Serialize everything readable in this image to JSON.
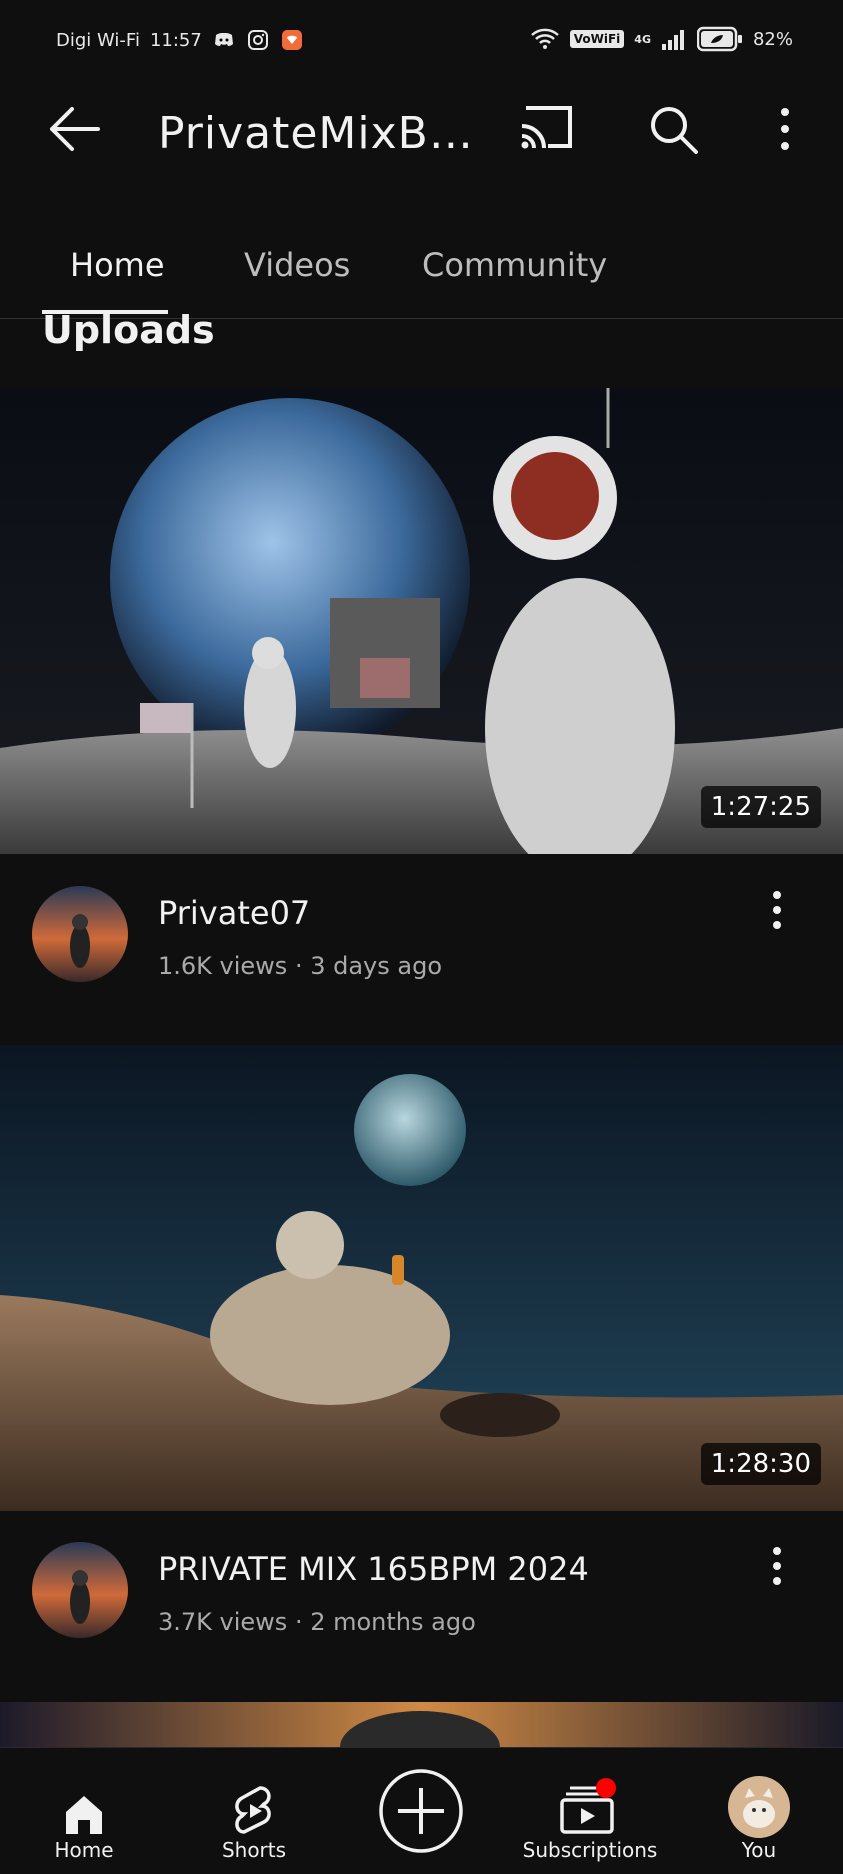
{
  "status": {
    "carrier": "Digi Wi-Fi",
    "time": "11:57",
    "vowifi": "VoWiFi",
    "network": "4G",
    "battery": "82%"
  },
  "header": {
    "title": "PrivateMixBi ..."
  },
  "tabs": [
    {
      "label": "Home"
    },
    {
      "label": "Videos"
    },
    {
      "label": "Community"
    }
  ],
  "section_title": "Uploads",
  "videos": [
    {
      "title": "Private07",
      "views": "1.6K views",
      "age": "3 days ago",
      "duration": "1:27:25"
    },
    {
      "title": "PRIVATE MIX 165BPM 2024",
      "views": "3.7K views",
      "age": "2 months ago",
      "duration": "1:28:30"
    }
  ],
  "meta_separator": " · ",
  "nav": [
    {
      "label": "Home"
    },
    {
      "label": "Shorts"
    },
    {
      "label": ""
    },
    {
      "label": "Subscriptions"
    },
    {
      "label": "You"
    }
  ],
  "colors": {
    "background": "#0f0f0f",
    "text": "#f1f1f1",
    "secondary_text": "#aaaaaa",
    "badge": "#ff0000"
  }
}
